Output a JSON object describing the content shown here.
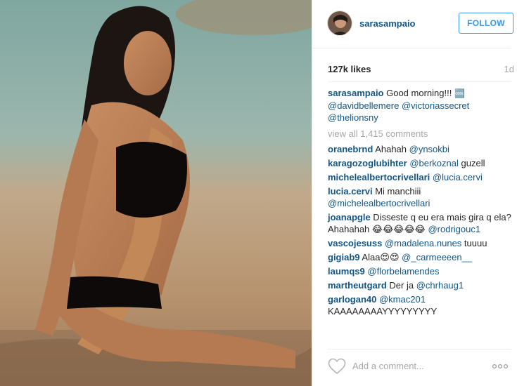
{
  "post": {
    "username": "sarasampaio",
    "follow_label": "FOLLOW",
    "likes": "127k likes",
    "time": "1d",
    "caption": {
      "user": "sarasampaio",
      "text": " Good morning!!! ",
      "emoji": "🆒",
      "mentions": [
        "@davidbellemere",
        "@victoriassecret",
        "@thelionsny"
      ]
    },
    "view_all": "view all 1,415 comments",
    "comments": [
      {
        "user": "oranebrnd",
        "before": " Ahahah ",
        "mention": "@ynsokbi",
        "after": ""
      },
      {
        "user": "karagozoglubihter",
        "before": " ",
        "mention": "@berkoznal",
        "after": " guzell"
      },
      {
        "user": "michelealbertocrivellari",
        "before": " ",
        "mention": "@lucia.cervi",
        "after": ""
      },
      {
        "user": "lucia.cervi",
        "before": " Mi manchiii ",
        "mention": "@michelealbertocrivellari",
        "after": ""
      },
      {
        "user": "joanapgle",
        "before": " Disseste q eu era mais gira q ela? Ahahahah 😂😂😂😂😂 ",
        "mention": "@rodrigouc1",
        "after": ""
      },
      {
        "user": "vascojesuss",
        "before": " ",
        "mention": "@madalena.nunes",
        "after": " tuuuu"
      },
      {
        "user": "gigiab9",
        "before": " Alaa😍😍 ",
        "mention": "@_carmeeeen__",
        "after": ""
      },
      {
        "user": "laumqs9",
        "before": " ",
        "mention": "@florbelamendes",
        "after": ""
      },
      {
        "user": "martheutgard",
        "before": " Der ja ",
        "mention": "@chrhaug1",
        "after": ""
      },
      {
        "user": "garlogan40",
        "before": " ",
        "mention": "@kmac201",
        "after": " KAAAAAAAAYYYYYYYYY"
      }
    ],
    "add_comment_placeholder": "Add a comment...",
    "icons": {
      "like": "heart-icon",
      "more": "more-options-icon"
    },
    "colors": {
      "link": "#125688",
      "follow": "#3897f0",
      "muted": "#a5a7aa"
    }
  }
}
